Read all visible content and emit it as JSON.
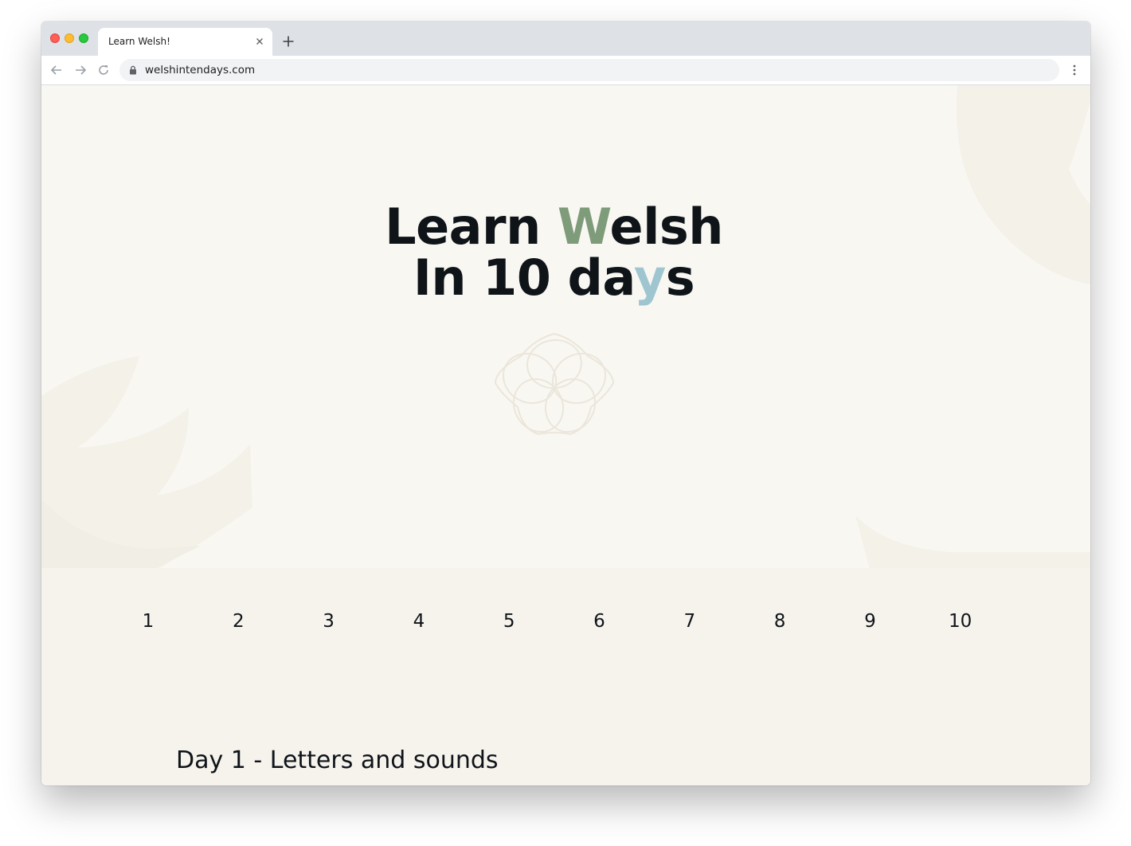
{
  "browser": {
    "tab": {
      "title": "Learn Welsh!"
    },
    "address_bar": {
      "url": "welshintendays.com"
    },
    "icons": {
      "close": "close-icon",
      "new_tab": "plus-icon",
      "back": "arrow-left-icon",
      "forward": "arrow-right-icon",
      "reload": "reload-icon",
      "lock": "lock-icon",
      "menu": "more-vert-icon"
    }
  },
  "hero": {
    "title_line1": {
      "before": "Learn ",
      "accent": "W",
      "after": "elsh"
    },
    "title_line2": {
      "before": "In 10 da",
      "accent": "y",
      "after": "s"
    },
    "accent_colors": {
      "green": "#7e9b7a",
      "blue": "#9fc6d0"
    },
    "emblem": "flower-knot-icon"
  },
  "day_nav": [
    "1",
    "2",
    "3",
    "4",
    "5",
    "6",
    "7",
    "8",
    "9",
    "10"
  ],
  "section": {
    "heading": "Day 1 - Letters and sounds"
  },
  "colors": {
    "page_background": "#f6f3ec",
    "text": "#0f1419"
  }
}
